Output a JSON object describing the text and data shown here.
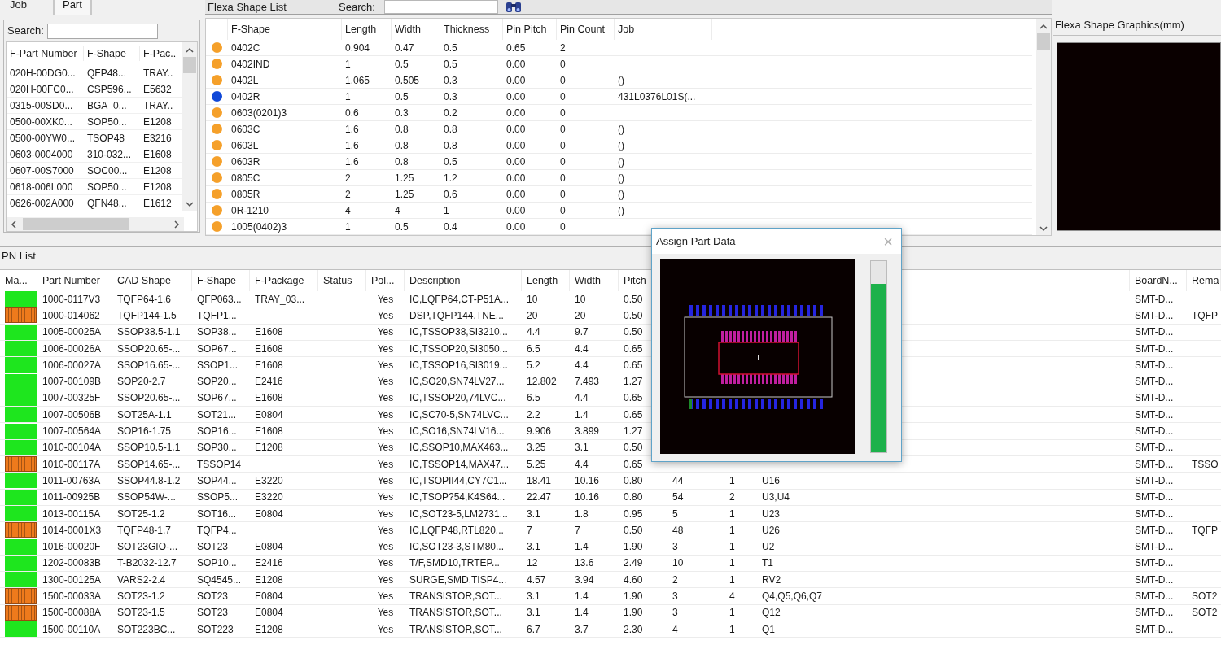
{
  "left_panel": {
    "tabs": [
      {
        "label": "Job",
        "selected": false
      },
      {
        "label": "Part",
        "selected": true
      }
    ],
    "search": {
      "label": "Search:"
    },
    "table": {
      "columns": [
        "F-Part Number",
        "F-Shape",
        "F-Pac.."
      ],
      "rows": [
        [
          "020H-00DG0...",
          "QFP48...",
          "TRAY.."
        ],
        [
          "020H-00FC0...",
          "CSP596...",
          "E5632"
        ],
        [
          "0315-00SD0...",
          "BGA_0...",
          "TRAY.."
        ],
        [
          "0500-00XK0...",
          "SOP50...",
          "E1208"
        ],
        [
          "0500-00YW0...",
          "TSOP48",
          "E3216"
        ],
        [
          "0603-0004000",
          "310-032...",
          "E1608"
        ],
        [
          "0607-00S7000",
          "SOC00...",
          "E1208"
        ],
        [
          "0618-006L000",
          "SOP50...",
          "E1208"
        ],
        [
          "0626-002A000",
          "QFN48...",
          "E1612"
        ]
      ]
    }
  },
  "shape_list": {
    "title": "Flexa Shape List",
    "search": {
      "label": "Search:"
    },
    "columns": [
      "F-Shape",
      "Length",
      "Width",
      "Thickness",
      "Pin Pitch",
      "Pin Count",
      "Job"
    ],
    "rows": [
      {
        "color": "#f5a02a",
        "cells": [
          "0402C",
          "0.904",
          "0.47",
          "0.5",
          "0.65",
          "2"
        ]
      },
      {
        "color": "#f5a02a",
        "cells": [
          "0402IND",
          "1",
          "0.5",
          "0.5",
          "0.00",
          "0"
        ]
      },
      {
        "color": "#f5a02a",
        "cells": [
          "0402L",
          "1.065",
          "0.505",
          "0.3",
          "0.00",
          "0",
          "()"
        ]
      },
      {
        "color": "#1048d8",
        "cells": [
          "0402R",
          "1",
          "0.5",
          "0.3",
          "0.00",
          "0",
          "431L0376L01S(..."
        ]
      },
      {
        "color": "#f5a02a",
        "cells": [
          "0603(0201)3",
          "0.6",
          "0.3",
          "0.2",
          "0.00",
          "0"
        ]
      },
      {
        "color": "#f5a02a",
        "cells": [
          "0603C",
          "1.6",
          "0.8",
          "0.8",
          "0.00",
          "0",
          "()"
        ]
      },
      {
        "color": "#f5a02a",
        "cells": [
          "0603L",
          "1.6",
          "0.8",
          "0.8",
          "0.00",
          "0",
          "()"
        ]
      },
      {
        "color": "#f5a02a",
        "cells": [
          "0603R",
          "1.6",
          "0.8",
          "0.5",
          "0.00",
          "0",
          "()"
        ]
      },
      {
        "color": "#f5a02a",
        "cells": [
          "0805C",
          "2",
          "1.25",
          "1.2",
          "0.00",
          "0",
          "()"
        ]
      },
      {
        "color": "#f5a02a",
        "cells": [
          "0805R",
          "2",
          "1.25",
          "0.6",
          "0.00",
          "0",
          "()"
        ]
      },
      {
        "color": "#f5a02a",
        "cells": [
          "0R-1210",
          "4",
          "4",
          "1",
          "0.00",
          "0",
          "()"
        ]
      },
      {
        "color": "#f5a02a",
        "cells": [
          "1005(0402)3",
          "1",
          "0.5",
          "0.4",
          "0.00",
          "0"
        ]
      }
    ]
  },
  "graphics": {
    "title": "Flexa Shape Graphics(mm)"
  },
  "pn_list": {
    "title": "PN List",
    "mark_column": "Ma...",
    "columns": [
      "Part Number",
      "CAD Shape",
      "F-Shape",
      "F-Package",
      "Status",
      "Pol...",
      "Description",
      "Length",
      "Width",
      "Pitch"
    ],
    "right_columns": [
      "BoardN...",
      "Rema"
    ],
    "rows": [
      {
        "matched": true,
        "cells": [
          "1000-0117V3",
          "TQFP64-1.6",
          "QFP063...",
          "TRAY_03...",
          "",
          "Yes",
          "IC,LQFP64,CT-P51A...",
          "10",
          "10",
          "0.50"
        ],
        "board": "SMT-D..."
      },
      {
        "matched": false,
        "cells": [
          "1000-014062",
          "TQFP144-1.5",
          "TQFP1...",
          "",
          "",
          "Yes",
          "DSP,TQFP144,TNE...",
          "20",
          "20",
          "0.50"
        ],
        "board": "SMT-D...",
        "remark": "TQFP"
      },
      {
        "matched": true,
        "cells": [
          "1005-00025A",
          "SSOP38.5-1.1",
          "SOP38...",
          "E1608",
          "",
          "Yes",
          "IC,TSSOP38,SI3210...",
          "4.4",
          "9.7",
          "0.50"
        ],
        "board": "SMT-D..."
      },
      {
        "matched": true,
        "cells": [
          "1006-00026A",
          "SSOP20.65-...",
          "SOP67...",
          "E1608",
          "",
          "Yes",
          "IC,TSSOP20,SI3050...",
          "6.5",
          "4.4",
          "0.65"
        ],
        "board": "SMT-D..."
      },
      {
        "matched": true,
        "cells": [
          "1006-00027A",
          "SSOP16.65-...",
          "SSOP1...",
          "E1608",
          "",
          "Yes",
          "IC,TSSOP16,SI3019...",
          "5.2",
          "4.4",
          "0.65"
        ],
        "board": "SMT-D..."
      },
      {
        "matched": true,
        "cells": [
          "1007-00109B",
          "SOP20-2.7",
          "SOP20...",
          "E2416",
          "",
          "Yes",
          "IC,SO20,SN74LV27...",
          "12.802",
          "7.493",
          "1.27"
        ],
        "board": "SMT-D..."
      },
      {
        "matched": true,
        "cells": [
          "1007-00325F",
          "SSOP20.65-...",
          "SOP67...",
          "E1608",
          "",
          "Yes",
          "IC,TSSOP20,74LVC...",
          "6.5",
          "4.4",
          "0.65"
        ],
        "board": "SMT-D..."
      },
      {
        "matched": true,
        "cells": [
          "1007-00506B",
          "SOT25A-1.1",
          "SOT21...",
          "E0804",
          "",
          "Yes",
          "IC,SC70-5,SN74LVC...",
          "2.2",
          "1.4",
          "0.65"
        ],
        "board": "SMT-D..."
      },
      {
        "matched": true,
        "cells": [
          "1007-00564A",
          "SOP16-1.75",
          "SOP16...",
          "E1608",
          "",
          "Yes",
          "IC,SO16,SN74LV16...",
          "9.906",
          "3.899",
          "1.27"
        ],
        "board": "SMT-D..."
      },
      {
        "matched": true,
        "cells": [
          "1010-00104A",
          "SSOP10.5-1.1",
          "SOP30...",
          "E1208",
          "",
          "Yes",
          "IC,SSOP10,MAX463...",
          "3.25",
          "3.1",
          "0.50"
        ],
        "board": "SMT-D..."
      },
      {
        "matched": false,
        "cells": [
          "1010-00117A",
          "SSOP14.65-...",
          "TSSOP14",
          "",
          "",
          "Yes",
          "IC,TSSOP14,MAX47...",
          "5.25",
          "4.4",
          "0.65"
        ],
        "board": "SMT-D...",
        "remark": "TSSO"
      },
      {
        "matched": true,
        "cells": [
          "1011-00763A",
          "SSOP44.8-1.2",
          "SOP44...",
          "E3220",
          "",
          "Yes",
          "IC,TSOPII44,CY7C1...",
          "18.41",
          "10.16",
          "0.80"
        ],
        "pin_count": "44",
        "quantity": "1",
        "reference": "U16",
        "board": "SMT-D..."
      },
      {
        "matched": true,
        "cells": [
          "1011-00925B",
          "SSOP54W-...",
          "SSOP5...",
          "E3220",
          "",
          "Yes",
          "IC,TSOP?54,K4S64...",
          "22.47",
          "10.16",
          "0.80"
        ],
        "pin_count": "54",
        "quantity": "2",
        "reference": "U3,U4",
        "board": "SMT-D..."
      },
      {
        "matched": true,
        "cells": [
          "1013-00115A",
          "SOT25-1.2",
          "SOT16...",
          "E0804",
          "",
          "Yes",
          "IC,SOT23-5,LM2731...",
          "3.1",
          "1.8",
          "0.95"
        ],
        "pin_count": "5",
        "quantity": "1",
        "reference": "U23",
        "board": "SMT-D..."
      },
      {
        "matched": false,
        "cells": [
          "1014-0001X3",
          "TQFP48-1.7",
          "TQFP4...",
          "",
          "",
          "Yes",
          "IC,LQFP48,RTL820...",
          "7",
          "7",
          "0.50"
        ],
        "pin_count": "48",
        "quantity": "1",
        "reference": "U26",
        "board": "SMT-D...",
        "remark": "TQFP"
      },
      {
        "matched": true,
        "cells": [
          "1016-00020F",
          "SOT23GIO-...",
          "SOT23",
          "E0804",
          "",
          "Yes",
          "IC,SOT23-3,STM80...",
          "3.1",
          "1.4",
          "1.90"
        ],
        "pin_count": "3",
        "quantity": "1",
        "reference": "U2",
        "board": "SMT-D..."
      },
      {
        "matched": true,
        "cells": [
          "1202-00083B",
          "T-B2032-12.7",
          "SOP10...",
          "E2416",
          "",
          "Yes",
          "T/F,SMD10,TRTEP...",
          "12",
          "13.6",
          "2.49"
        ],
        "pin_count": "10",
        "quantity": "1",
        "reference": "T1",
        "board": "SMT-D..."
      },
      {
        "matched": true,
        "cells": [
          "1300-00125A",
          "VARS2-2.4",
          "SQ4545...",
          "E1208",
          "",
          "Yes",
          "SURGE,SMD,TISP4...",
          "4.57",
          "3.94",
          "4.60"
        ],
        "pin_count": "2",
        "quantity": "1",
        "reference": "RV2",
        "board": "SMT-D..."
      },
      {
        "matched": false,
        "cells": [
          "1500-00033A",
          "SOT23-1.2",
          "SOT23",
          "E0804",
          "",
          "Yes",
          "TRANSISTOR,SOT...",
          "3.1",
          "1.4",
          "1.90"
        ],
        "pin_count": "3",
        "quantity": "4",
        "reference": "Q4,Q5,Q6,Q7",
        "board": "SMT-D...",
        "remark": "SOT2"
      },
      {
        "matched": false,
        "cells": [
          "1500-00088A",
          "SOT23-1.5",
          "SOT23",
          "E0804",
          "",
          "Yes",
          "TRANSISTOR,SOT...",
          "3.1",
          "1.4",
          "1.90"
        ],
        "pin_count": "3",
        "quantity": "1",
        "reference": "Q12",
        "board": "SMT-D...",
        "remark": "SOT2"
      },
      {
        "matched": true,
        "cells": [
          "1500-00110A",
          "SOT223BC...",
          "SOT223",
          "E1208",
          "",
          "Yes",
          "TRANSISTOR,SOT...",
          "6.7",
          "3.7",
          "2.30"
        ],
        "pin_count": "4",
        "quantity": "1",
        "reference": "Q1",
        "board": "SMT-D..."
      }
    ]
  },
  "dialog": {
    "title": "Assign Part Data",
    "close": "×",
    "progress": {
      "level": 0.88
    }
  }
}
